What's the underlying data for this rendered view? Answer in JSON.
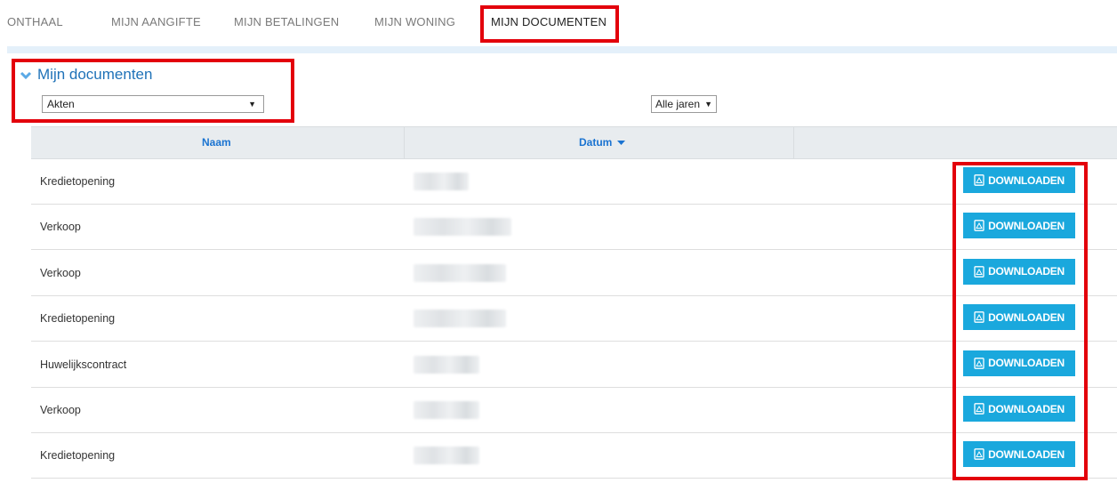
{
  "tabs": [
    {
      "label": "ONTHAAL"
    },
    {
      "label": "MIJN AANGIFTE"
    },
    {
      "label": "MIJN BETALINGEN"
    },
    {
      "label": "MIJN WONING"
    },
    {
      "label": "MIJN DOCUMENTEN",
      "active": true
    }
  ],
  "section": {
    "title": "Mijn documenten"
  },
  "filters": {
    "type_select": {
      "value": "Akten"
    },
    "year_select": {
      "value": "Alle jaren"
    }
  },
  "table": {
    "headers": {
      "naam": "Naam",
      "datum": "Datum"
    },
    "rows": [
      {
        "naam": "Kredietopening",
        "datum_hidden": true
      },
      {
        "naam": "Verkoop",
        "datum_hidden": true
      },
      {
        "naam": "Verkoop",
        "datum_hidden": true
      },
      {
        "naam": "Kredietopening",
        "datum_hidden": true
      },
      {
        "naam": "Huwelijkscontract",
        "datum_hidden": true
      },
      {
        "naam": "Verkoop",
        "datum_hidden": true
      },
      {
        "naam": "Kredietopening",
        "datum_hidden": true
      }
    ],
    "download_label": "DOWNLOADEN"
  },
  "colors": {
    "accent": "#1aa8dd",
    "link": "#1f72b8",
    "highlight": "#e3000b",
    "header_bg": "#e8ecef"
  }
}
